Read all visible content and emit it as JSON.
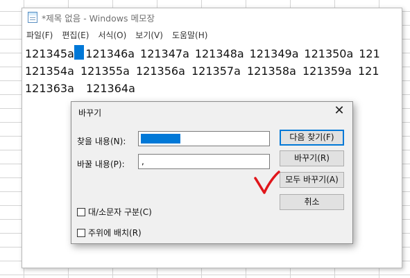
{
  "window": {
    "title": "*제목 없음 - Windows 메모장"
  },
  "menu": [
    {
      "label": "파일(F)"
    },
    {
      "label": "편집(E)"
    },
    {
      "label": "서식(O)"
    },
    {
      "label": "보기(V)"
    },
    {
      "label": "도움말(H)"
    }
  ],
  "editor": {
    "lines": [
      [
        "121345a",
        "121346a",
        "121347a",
        "121348a",
        "121349a",
        "121350a",
        "121"
      ],
      [
        "121354a",
        "121355a",
        "121356a",
        "121357a",
        "121358a",
        "121359a",
        "121"
      ],
      [
        "121363a",
        "121364a"
      ]
    ]
  },
  "dialog": {
    "title": "바꾸기",
    "find_label": "찾을 내용(N):",
    "find_value": "",
    "replace_label": "바꿀 내용(P):",
    "replace_value": ",",
    "buttons": {
      "find_next": "다음 찾기(F)",
      "replace": "바꾸기(R)",
      "replace_all": "모두 바꾸기(A)",
      "cancel": "취소"
    },
    "match_case": {
      "label": "대/소문자 구분(C)",
      "checked": false
    },
    "wrap_around": {
      "label": "주위에 배치(R)",
      "checked": false
    }
  },
  "colors": {
    "selection": "#0078d7",
    "annotation": "#e0161b",
    "dialog_bg": "#f0f0f0"
  }
}
